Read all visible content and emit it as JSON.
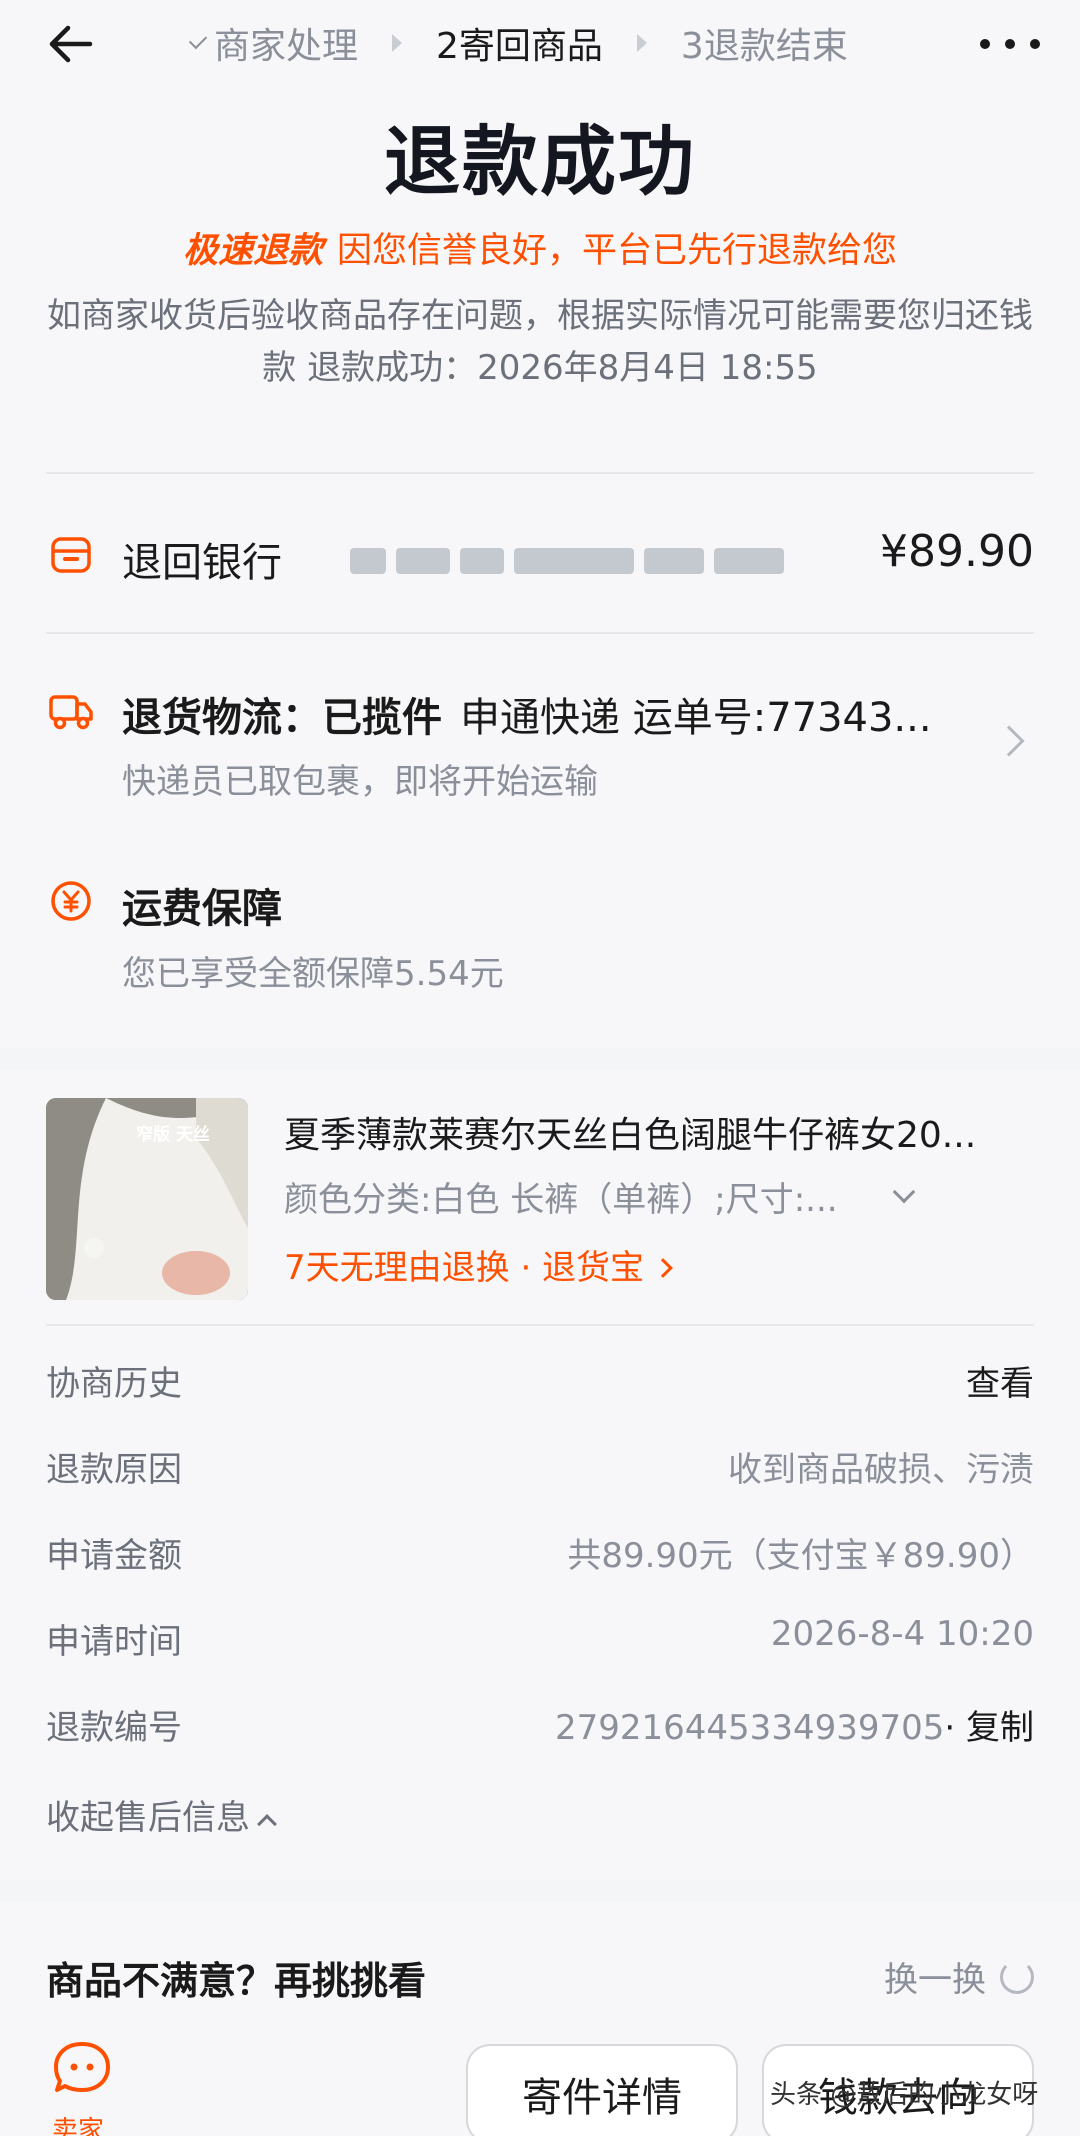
{
  "nav": {
    "steps": [
      {
        "label": "商家处理",
        "state": "done"
      },
      {
        "label": "2寄回商品",
        "state": "active"
      },
      {
        "label": "3退款结束",
        "state": "pending"
      }
    ]
  },
  "header": {
    "title": "退款成功",
    "fast_tag": "极速退款",
    "fast_text": "因您信誉良好，平台已先行退款给您",
    "desc": "如商家收货后验收商品存在问题，根据实际情况可能需要您归还钱款 退款成功：2026年8月4日 18:55"
  },
  "refund": {
    "label": "退回银行",
    "amount": "¥89.90"
  },
  "logistics": {
    "title_bold": "退货物流：已揽件",
    "title_rest": "申通快递 运单号:77343...",
    "subtitle": "快递员已取包裹，即将开始运输"
  },
  "shipping": {
    "title": "运费保障",
    "subtitle": "您已享受全额保障5.54元"
  },
  "product": {
    "thumb_tag": "窄版 天丝",
    "name": "夏季薄款莱赛尔天丝白色阔腿牛仔裤女20...",
    "spec": "颜色分类:白色 长裤（单裤）;尺寸:...",
    "policy": "7天无理由退换 · 退货宝"
  },
  "info": {
    "rows": [
      {
        "key": "协商历史",
        "value": "查看"
      },
      {
        "key": "退款原因",
        "value": "收到商品破损、污渍"
      },
      {
        "key": "申请金额",
        "value": "共89.90元（支付宝￥89.90）"
      },
      {
        "key": "申请时间",
        "value": "2026-8-4 10:20"
      },
      {
        "key": "退款编号",
        "value": "279216445334939705",
        "action": "· 复制"
      }
    ],
    "collapse": "收起售后信息"
  },
  "recommend": {
    "title": "商品不满意？再挑挑看",
    "swap": "换一换"
  },
  "bottom": {
    "seller": "卖家",
    "ship_detail": "寄件详情",
    "money_flow": "钱款去向",
    "watermark": "头条 @敖后的小龙女呀"
  },
  "colors": {
    "accent": "#ff5000",
    "text": "#1a1a1a",
    "muted": "#8a8f99"
  }
}
